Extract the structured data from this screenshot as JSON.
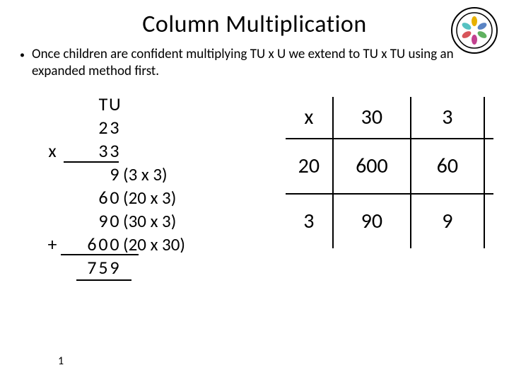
{
  "title": "Column Multiplication",
  "bullet": "Once children are confident multiplying TU x U we extend to TU x TU using an expanded method first.",
  "calc": {
    "header_t": "T",
    "header_u": "U",
    "n1_t": "2",
    "n1_u": "3",
    "op_mul": "x",
    "n2_t": "3",
    "n2_u": "3",
    "p1": "9",
    "p1_note": "(3 x 3)",
    "p2_t": "6",
    "p2_u": "0",
    "p2_note": "(20 x 3)",
    "p3_t": "9",
    "p3_u": "0",
    "p3_note": "(30 x 3)",
    "op_add": "+",
    "p4_h": "6",
    "p4_t": "0",
    "p4_u": "0",
    "p4_note": "(20 x 30)",
    "r_h": "7",
    "r_t": "5",
    "r_u": "9"
  },
  "grid": {
    "sym": "x",
    "c0": "30",
    "c1": "3",
    "r0": "20",
    "r1": "3",
    "d00": "600",
    "d01": "60",
    "d10": "90",
    "d11": "9"
  },
  "page": "1"
}
